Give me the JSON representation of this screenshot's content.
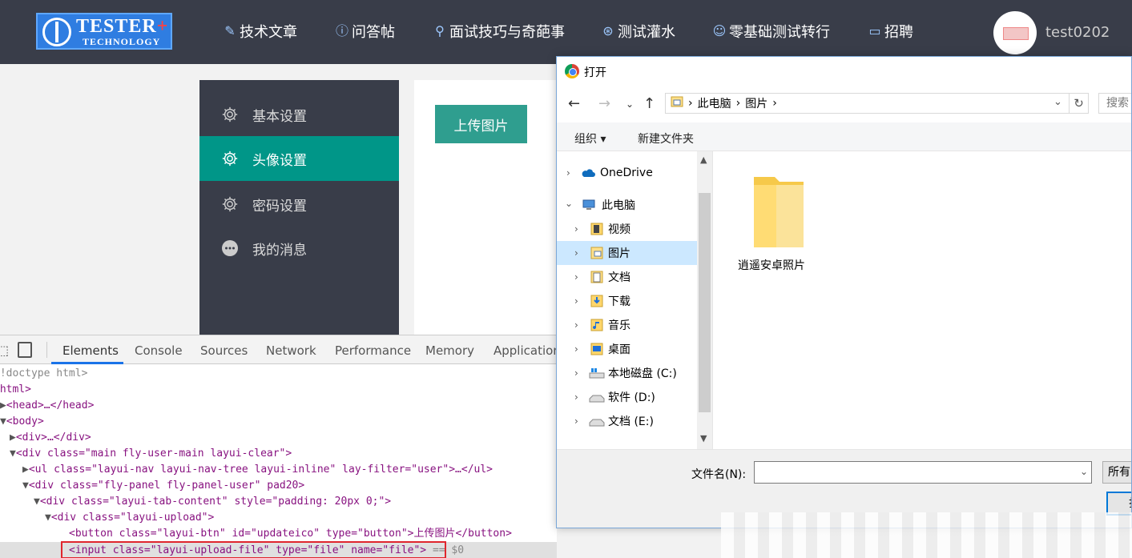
{
  "nav": {
    "logo_line1": "TESTER",
    "logo_plus": "+",
    "logo_line2": "TECHNOLOGY",
    "items": [
      {
        "label": "技术文章",
        "icon": "pencil-icon"
      },
      {
        "label": "问答帖",
        "icon": "question-icon"
      },
      {
        "label": "面试技巧与奇葩事",
        "icon": "search-icon"
      },
      {
        "label": "测试灌水",
        "icon": "chat-icon"
      },
      {
        "label": "零基础测试转行",
        "icon": "face-icon"
      },
      {
        "label": "招聘",
        "icon": "message-icon"
      }
    ],
    "username": "test0202"
  },
  "user_menu": {
    "items": [
      {
        "label": "基本设置",
        "icon": "gear-icon",
        "active": false
      },
      {
        "label": "头像设置",
        "icon": "gear-icon",
        "active": true
      },
      {
        "label": "密码设置",
        "icon": "gear-icon",
        "active": false
      },
      {
        "label": "我的消息",
        "icon": "chat-bubble-icon",
        "active": false
      }
    ]
  },
  "main": {
    "upload_label": "上传图片"
  },
  "devtools": {
    "tabs": [
      "Elements",
      "Console",
      "Sources",
      "Network",
      "Performance",
      "Memory",
      "Application"
    ],
    "active_tab": "Elements",
    "lines": [
      {
        "text": "<!doctype html>"
      },
      {
        "text": "<html>"
      },
      {
        "text": "<head>…</head>"
      },
      {
        "text": "<body>"
      },
      {
        "text": "<div>…</div>"
      },
      {
        "text": "<div class=\"main fly-user-main layui-clear\">"
      },
      {
        "text": "<ul class=\"layui-nav layui-nav-tree layui-inline\" lay-filter=\"user\">…</ul>"
      },
      {
        "text": "<div class=\"fly-panel fly-panel-user\" pad20>"
      },
      {
        "text": "<div class=\"layui-tab-content\" style=\"padding: 20px 0;\">"
      },
      {
        "text": "<div class=\"layui-upload\">"
      },
      {
        "text": "<button class=\"layui-btn\" id=\"updateico\" type=\"button\">上传图片</button>"
      },
      {
        "text": "<input class=\"layui-upload-file\" type=\"file\" name=\"file\">"
      },
      {
        "text": "== $0"
      }
    ]
  },
  "dialog": {
    "title": "打开",
    "address": [
      "此电脑",
      "图片"
    ],
    "search_placeholder": "搜索",
    "organize_label": "组织 ▾",
    "new_folder_label": "新建文件夹",
    "tree": [
      {
        "label": "OneDrive",
        "icon": "cloud-icon"
      },
      {
        "label": "此电脑",
        "icon": "computer-icon"
      },
      {
        "label": "视频",
        "icon": "video-folder-icon"
      },
      {
        "label": "图片",
        "icon": "pictures-folder-icon"
      },
      {
        "label": "文档",
        "icon": "documents-folder-icon"
      },
      {
        "label": "下载",
        "icon": "downloads-folder-icon"
      },
      {
        "label": "音乐",
        "icon": "music-folder-icon"
      },
      {
        "label": "桌面",
        "icon": "desktop-folder-icon"
      },
      {
        "label": "本地磁盘 (C:)",
        "icon": "windows-drive-icon"
      },
      {
        "label": "软件 (D:)",
        "icon": "drive-icon"
      },
      {
        "label": "文档 (E:)",
        "icon": "drive-icon"
      }
    ],
    "selected_tree_item": "图片",
    "folders": [
      {
        "name": "逍遥安卓照片",
        "icon": "folder-icon"
      }
    ],
    "filename_label": "文件名(N):",
    "filename_value": "",
    "filetype_label": "所有",
    "open_label": "打"
  }
}
